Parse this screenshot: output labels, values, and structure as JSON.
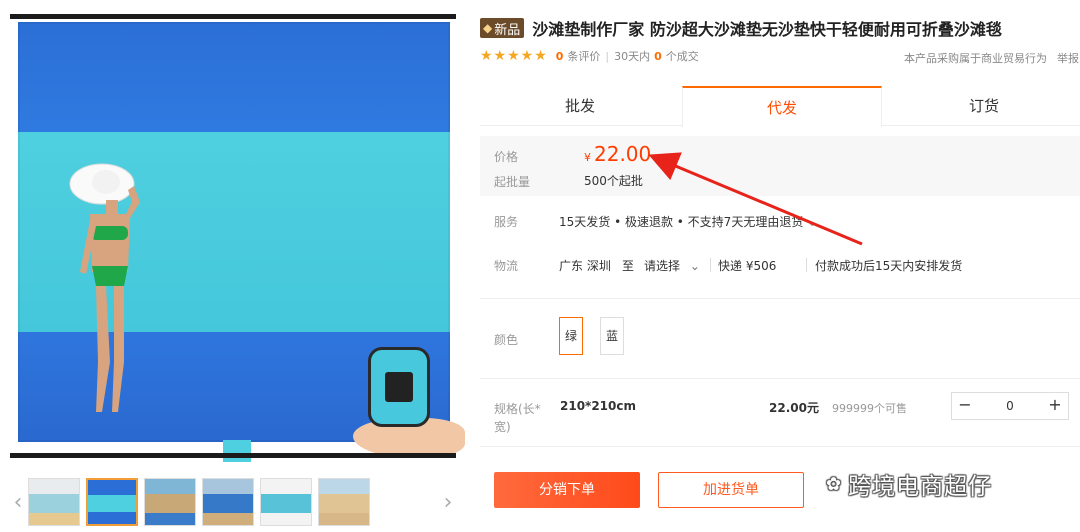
{
  "product": {
    "badge": "新品",
    "title": "沙滩垫制作厂家 防沙超大沙滩垫无沙垫快干轻便耐用可折叠沙滩毯",
    "rating_stars": "★★★★★",
    "review_count": "0",
    "review_label": "条评价",
    "sales_prefix": "30天内",
    "sales_count": "0",
    "sales_suffix": "个成交",
    "notice": "本产品采购属于商业贸易行为",
    "notice_more": "举报"
  },
  "tabs": [
    {
      "label": "批发",
      "active": false
    },
    {
      "label": "代发",
      "active": true
    },
    {
      "label": "订货",
      "active": false
    }
  ],
  "pricing": {
    "price_label": "价格",
    "currency": "¥",
    "price": "22.00",
    "moq_label": "起批量",
    "moq": "500个起批"
  },
  "service": {
    "label": "服务",
    "text": "15天发货 • 极速退款 • 不支持7天无理由退货",
    "chevron": "⌄"
  },
  "logistics": {
    "label": "物流",
    "origin": "广东 深圳",
    "to": "至",
    "dest": "请选择",
    "chevron": "⌄",
    "shipping": "快递 ¥506",
    "note": "付款成功后15天内安排发货"
  },
  "color": {
    "label": "颜色",
    "options": [
      {
        "label": "绿",
        "selected": true
      },
      {
        "label": "蓝",
        "selected": false
      }
    ]
  },
  "spec": {
    "label": "规格(长*宽)",
    "size": "210*210cm",
    "price": "22.00元",
    "stock": "999999个可售",
    "minus": "−",
    "quantity": "0",
    "plus": "+"
  },
  "actions": {
    "order": "分销下单",
    "cart": "加进货单"
  },
  "gallery": {
    "prev": "‹",
    "next": "›",
    "thumbnail_count": 6,
    "active_index": 1
  },
  "watermark": {
    "text": "跨境电商超仔"
  },
  "colors": {
    "accent": "#ff6a00",
    "price": "#ff3d00",
    "arrow": "#e8231a",
    "mat_blue": "#2b6fd6",
    "mat_cyan": "#4fd0e0"
  }
}
